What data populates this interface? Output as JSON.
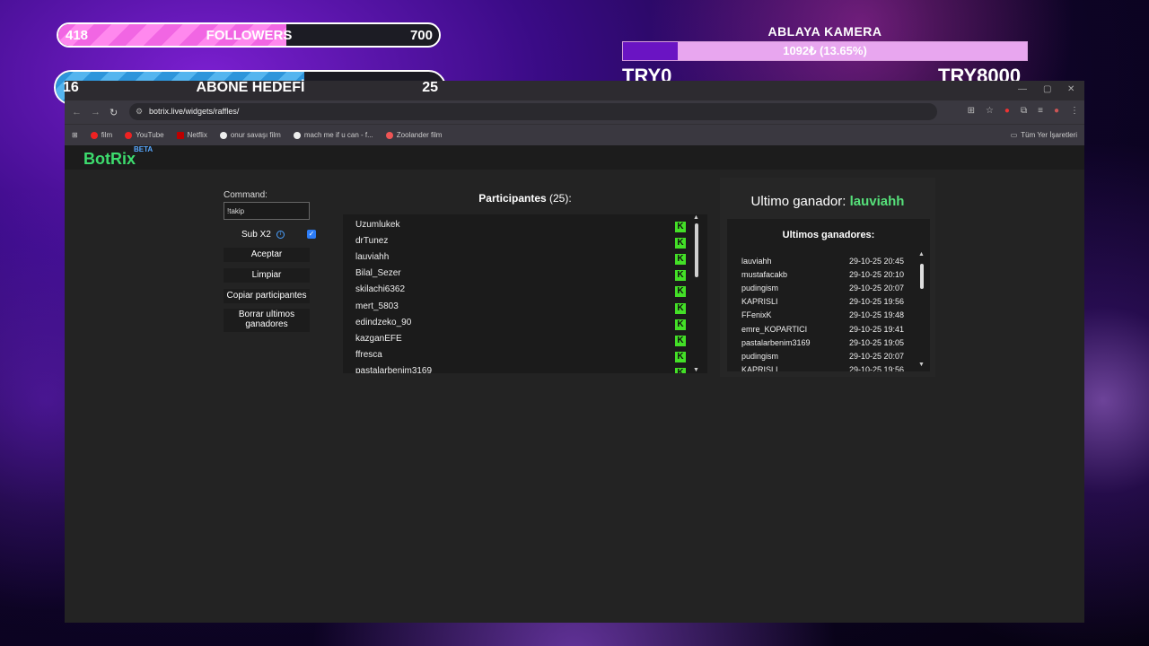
{
  "overlay": {
    "followers": {
      "current": "418",
      "label": "FOLLOWERS",
      "goal": "700",
      "progress": 0.6
    },
    "abone": {
      "current": "16",
      "label": "ABONE HEDEFİ",
      "goal": "25",
      "progress": 0.64
    },
    "camera": {
      "title": "ABLAYA KAMERA",
      "amount": "1092₺ (13.65%)",
      "progress": 0.1365,
      "min": "TRY0",
      "max": "TRY8000"
    }
  },
  "browser": {
    "url": "botrix.live/widgets/raffles/",
    "bookmarks": [
      "film",
      "YouTube",
      "Netflix",
      "onur savaşı film",
      "mach me if u can - f...",
      "Zoolander film"
    ],
    "all_bookmarks": "Tüm Yer İşaretleri"
  },
  "app": {
    "brand": "BotRix",
    "brand_tag": "BETA",
    "command_label": "Command:",
    "command_value": "!takip",
    "sub_label": "Sub X2",
    "sub_checked": true,
    "buttons": [
      "Aceptar",
      "Limpiar",
      "Copiar participantes",
      "Borrar ultimos ganadores"
    ],
    "participants_title": "Participantes",
    "participants_count": "(25):",
    "participants": [
      "Uzumlukek",
      "drTunez",
      "lauviahh",
      "Bilal_Sezer",
      "skilachi6362",
      "mert_5803",
      "edindzeko_90",
      "kazganEFE",
      "ffresca",
      "pastalarbenim3169"
    ],
    "winner_label": "Ultimo ganador:",
    "winner_name": "lauviahh",
    "last_winners_title": "Ultimos ganadores:",
    "last_winners": [
      {
        "name": "lauviahh",
        "date": "29-10-25 20:45"
      },
      {
        "name": "mustafacakb",
        "date": "29-10-25 20:10"
      },
      {
        "name": "pudingism",
        "date": "29-10-25 20:07"
      },
      {
        "name": "KAPRISLI",
        "date": "29-10-25 19:56"
      },
      {
        "name": "FFenixK",
        "date": "29-10-25 19:48"
      },
      {
        "name": "emre_KOPARTICI",
        "date": "29-10-25 19:41"
      },
      {
        "name": "pastalarbenim3169",
        "date": "29-10-25 19:05"
      },
      {
        "name": "pudingism",
        "date": "29-10-25 20:07"
      },
      {
        "name": "KAPRISLI",
        "date": "29-10-25 19:56"
      }
    ]
  }
}
